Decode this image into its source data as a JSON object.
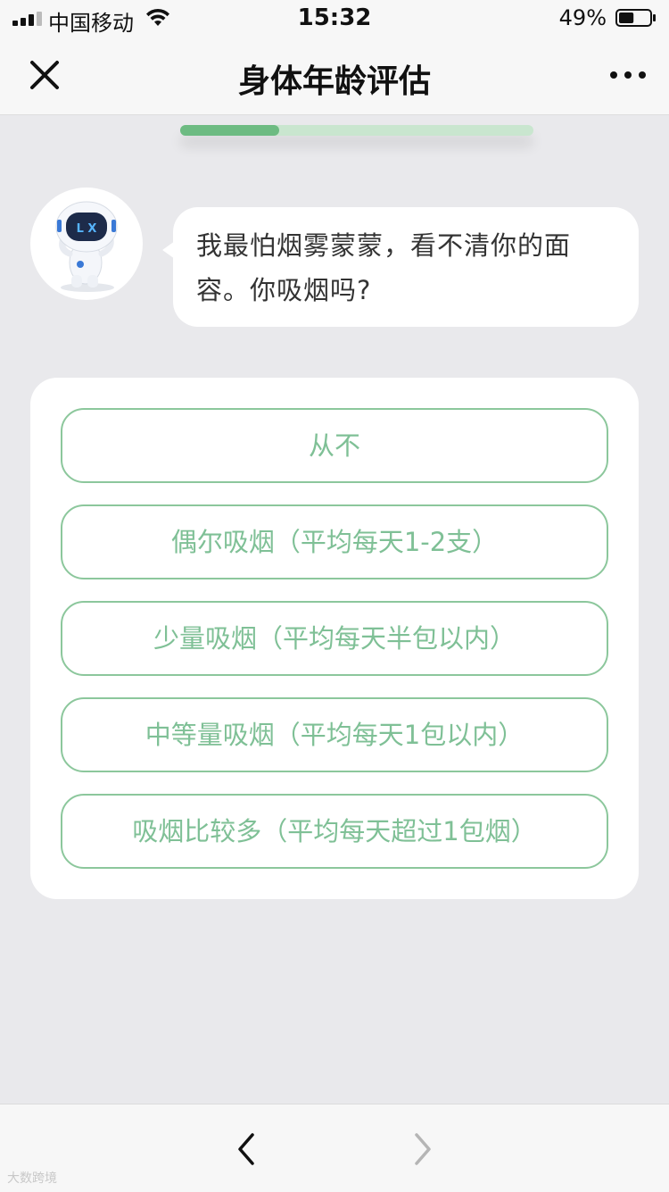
{
  "status_bar": {
    "carrier": "中国移动",
    "time": "15:32",
    "battery_percent": "49%",
    "battery_level": 0.49,
    "icons": [
      "signal-icon",
      "wifi-icon",
      "battery-icon"
    ]
  },
  "nav": {
    "title": "身体年龄评估",
    "close_icon": "close-icon",
    "more_icon": "more-icon"
  },
  "progress": {
    "value": 0.28
  },
  "bot": {
    "avatar": "robot-avatar",
    "avatar_badge": "L X",
    "message": "我最怕烟雾蒙蒙，看不清你的面容。你吸烟吗?"
  },
  "options": [
    {
      "label": "从不"
    },
    {
      "label": "偶尔吸烟（平均每天1-2支）"
    },
    {
      "label": "少量吸烟（平均每天半包以内）"
    },
    {
      "label": "中等量吸烟（平均每天1包以内）"
    },
    {
      "label": "吸烟比较多（平均每天超过1包烟）"
    }
  ],
  "bottom_bar": {
    "back_icon": "chevron-left-icon",
    "forward_icon": "chevron-right-icon",
    "watermark": "大数跨境"
  },
  "colors": {
    "accent": "#6dbb82",
    "option_border": "#8cc79c",
    "option_text": "#7fc096",
    "background": "#e9e9ec"
  }
}
